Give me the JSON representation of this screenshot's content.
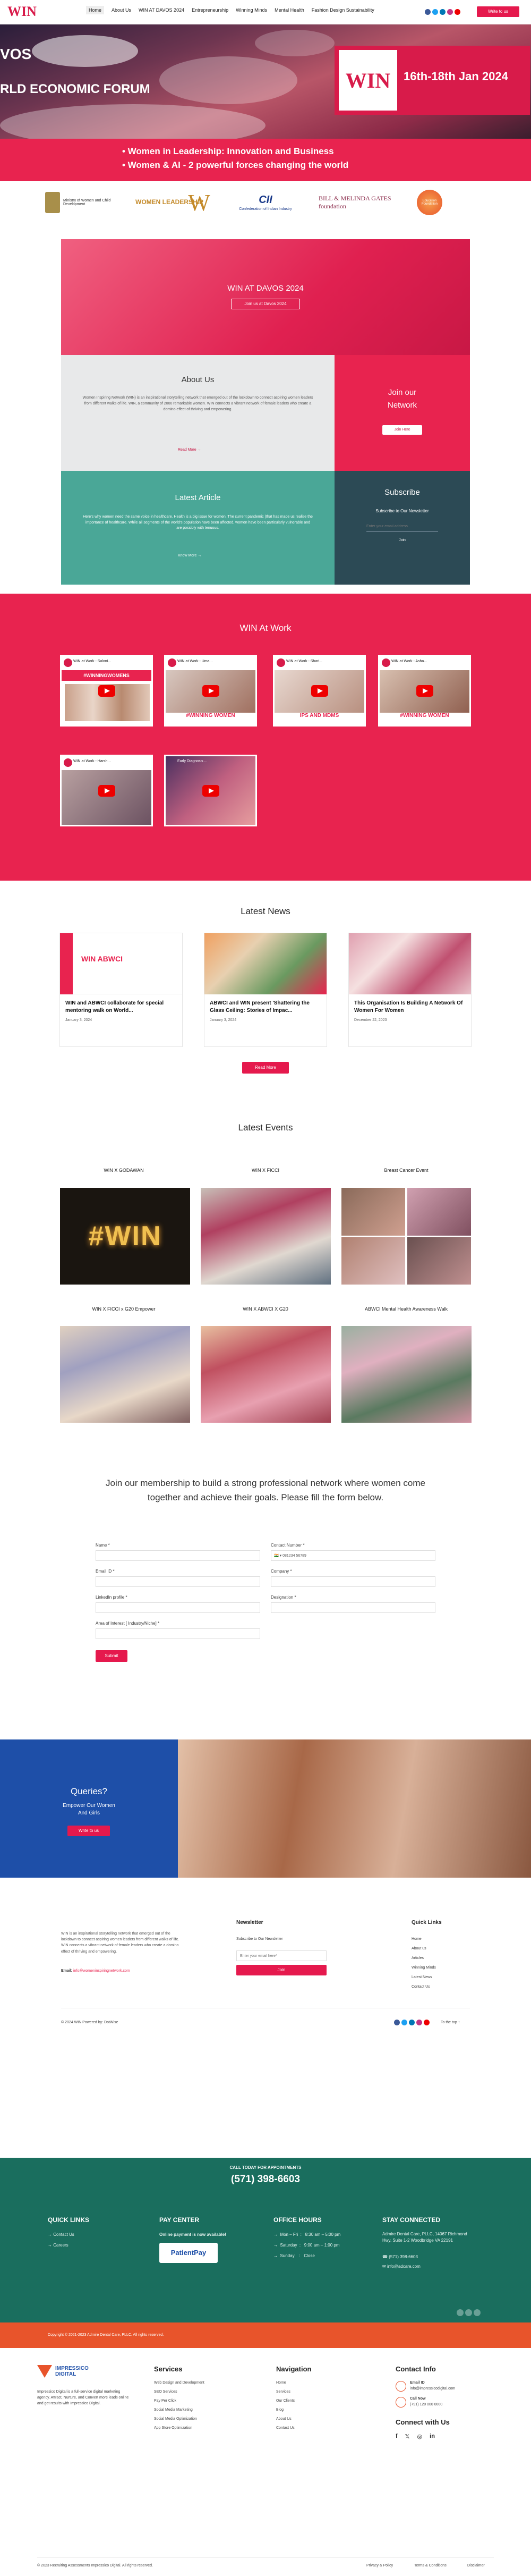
{
  "header": {
    "logo": "WIN",
    "nav": [
      "Home",
      "About Us",
      "WIN AT DAVOS 2024",
      "Entrepreneurship",
      "Winning Minds",
      "Mental Health",
      "Fashion Design Sustainability"
    ],
    "cta": "Write to us"
  },
  "hero": {
    "left_line1": "VOS",
    "left_line2": "RLD ECONOMIC FORUM",
    "logo": "WIN",
    "dates": "16th-18th Jan 2024",
    "bullets": [
      "• Women in Leadership: Innovation and Business",
      "• Women & AI - 2 powerful forces changing the world"
    ]
  },
  "partners": [
    "Ministry of Women and Child Development",
    "WOMEN LEADERSHIP",
    "W",
    "Confederation of Indian Industry",
    "BILL & MELINDA GATES foundation",
    "Education Foundation"
  ],
  "davos": {
    "title": "WIN AT DAVOS 2024",
    "join_btn": "Join us at Davos 2024",
    "about_title": "About Us",
    "about_text": "Women Inspiring Network (WIN) is an inspirational storytelling network that emerged out of the lockdown to connect aspiring women leaders from different walks of life. WIN, a community of 2000 remarkable women. WIN connects a vibrant network of female leaders who create a domino effect of thriving and empowering.",
    "read_more": "Read More",
    "join_title_1": "Join our",
    "join_title_2": "Network",
    "join_btn2": "Join Here",
    "article_title": "Latest Article",
    "article_text": "Here's why women need the same voice in healthcare. Health is a big issue for women. The current pandemic (that has made us realise the importance of healthcare. While all segments of the world's population have been affected, women have been particularly vulnerable and are possibly with tenuous.",
    "know_more": "Know More",
    "subscribe_title": "Subscribe",
    "subscribe_text": "Subscribe to Our Newsletter",
    "email_placeholder": "Enter your email address",
    "join_btn3": "Join"
  },
  "win_work": {
    "title": "WIN At Work",
    "videos": [
      {
        "title": "WIN at Work - Saloni...",
        "caption": "#WINNINGWOMENS"
      },
      {
        "title": "WIN at Work - Uma...",
        "caption": "#WINNING WOMEN"
      },
      {
        "title": "WIN at Work - Shari...",
        "caption": "IPS AND MDMS"
      },
      {
        "title": "WIN at Work - Asha...",
        "caption": "#WINNING WOMEN"
      },
      {
        "title": "WIN at Work - Harsh...",
        "caption": ""
      },
      {
        "title": "Early Diagnosis ...",
        "caption": ""
      }
    ]
  },
  "news": {
    "title": "Latest News",
    "items": [
      {
        "title": "WIN and ABWCI collaborate for special mentoring walk on World...",
        "date": "January 3, 2024",
        "img_text": "WIN ABWCI"
      },
      {
        "title": "ABWCI and WIN present 'Shattering the Glass Ceiling: Stories of Impac...",
        "date": "January 3, 2024",
        "img_text": ""
      },
      {
        "title": "This Organisation Is Building A Network Of Women For Women",
        "date": "December 22, 2023",
        "img_text": ""
      }
    ],
    "more_btn": "Read More"
  },
  "events": {
    "title": "Latest Events",
    "items": [
      "WIN X GODAWAN",
      "WIN X FICCI",
      "Breast Cancer Event",
      "WIN X FICCI x G20 Empower",
      "WIN X ABWCI X G20",
      "ABWCI Mental Health Awareness Walk"
    ],
    "win_text": "#WIN"
  },
  "form": {
    "heading": "Join our membership to build a strong professional network where women come together and achieve their goals. Please fill the form below.",
    "fields": [
      "Name *",
      "Contact Number *",
      "Email ID *",
      "Company *",
      "LinkedIn profile *",
      "Designation *",
      "Area of Interest [ Industry/Niche] *"
    ],
    "phone_prefix": "081234 56789",
    "submit": "Submit"
  },
  "queries": {
    "title": "Queries?",
    "sub": "Empower Our Women And Girls",
    "btn": "Write to us"
  },
  "footer": {
    "about": "WIN is an inspirational storytelling network that emerged out of the lockdown to connect aspiring women leaders from different walks of life. WIN connects a vibrant network of female leaders who create a domino effect of thriving and empowering.",
    "email_label": "Email:",
    "email": "info@womeninspiringnetwork.com",
    "newsletter_title": "Newsletter",
    "newsletter_text": "Subscribe to Our Newsletter",
    "newsletter_placeholder": "Enter your email here*",
    "newsletter_btn": "Join",
    "quick_title": "Quick Links",
    "quick_links": [
      "Home",
      "About us",
      "Articles",
      "Winning Minds",
      "Latest News",
      "Contact Us"
    ],
    "copyright": "© 2024 WIN Powered by: DotWise",
    "top": "To the top ↑"
  },
  "green": {
    "call": "CALL TODAY FOR APPOINTMENTS",
    "phone": "(571) 398-6603",
    "quick_title": "QUICK LINKS",
    "quick_links": [
      "→ Contact Us",
      "→ Careers"
    ],
    "pay_title": "PAY CENTER",
    "pay_text": "Online payment is now available!",
    "pay_logo": "PatientPay",
    "hours_title": "OFFICE HOURS",
    "hours": [
      "→  Mon – Fri  :   8:30 am – 5:00 pm",
      "→  Saturday  :   9:00 am – 1:00 pm",
      "→  Sunday    :   Close"
    ],
    "connect_title": "STAY CONNECTED",
    "address": "Admire Dental Care, PLLC, 14067 Richmond Hwy, Suite 1-2 Woodbridge VA 22191",
    "phone2": "(571) 398-6603",
    "email": "info@adcare.com"
  },
  "orange": {
    "copyright": "Copyright © 2021-2023 Admire Dental Care, PLLC. All rights reserved."
  },
  "final": {
    "company": "Impressico Digital is a full-service digital marketing agency. Attract, Nurture, and Convert more leads online and get results with Impressico Digital.",
    "services_title": "Services",
    "services": [
      "Web Design and Development",
      "SEO Services",
      "Pay Per Click",
      "Social Media Marketing",
      "Social Media Optimization",
      "App Store Optimization"
    ],
    "nav_title": "Navigation",
    "nav": [
      "Home",
      "Services",
      "Our Clients",
      "Blog",
      "About Us",
      "Contact Us"
    ],
    "contact_title": "Contact Info",
    "email_label": "Email ID",
    "email": "info@impressicodigital.com",
    "call_label": "Call Now",
    "phone": "(+91) 120 000 0000",
    "connect_title": "Connect with Us",
    "copyright": "© 2023 Recruiting Assessments Impressico Digital. All rights reserved.",
    "bottom_links": [
      "Privacy & Policy",
      "Terms & Conditions",
      "Disclaimer"
    ],
    "logo": "IMPRESSICO DIGITAL"
  },
  "colors": {
    "brand": "#e8234f",
    "teal": "#1a6e5e",
    "orange": "#e8542b",
    "blue": "#1e4fa8"
  }
}
